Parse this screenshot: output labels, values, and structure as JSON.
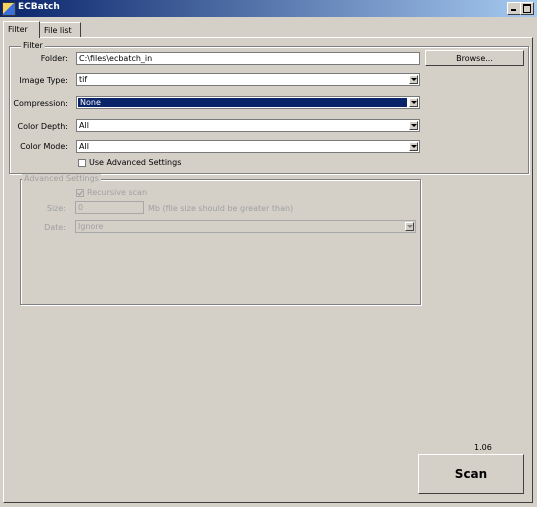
{
  "window": {
    "title": "ECBatch",
    "icon": "app-icon"
  },
  "tabs": [
    {
      "label": "Filter"
    },
    {
      "label": "File list"
    }
  ],
  "filter": {
    "legend": "Filter",
    "folder": {
      "label": "Folder:",
      "value": "C:\\files\\ecbatch_in",
      "browse_label": "Browse..."
    },
    "image_type": {
      "label": "Image Type:",
      "value": "tif"
    },
    "compression": {
      "label": "Compression:",
      "value": "None"
    },
    "color_depth": {
      "label": "Color Depth:",
      "value": "All"
    },
    "color_mode": {
      "label": "Color Mode:",
      "value": "All"
    },
    "use_advanced": {
      "label": "Use Advanced Settings",
      "checked": false
    }
  },
  "advanced": {
    "legend": "Advanced Settings",
    "recursive": {
      "label": "Recursive scan",
      "checked": true
    },
    "size": {
      "label": "Size:",
      "value": "0",
      "hint": "Mb (file size should be greater than)"
    },
    "date": {
      "label": "Date:",
      "value": "Ignore"
    }
  },
  "version": "1.06",
  "scan_label": "Scan",
  "colors": {
    "selection": "#0a246a",
    "window_bg": "#d4d0c8"
  }
}
